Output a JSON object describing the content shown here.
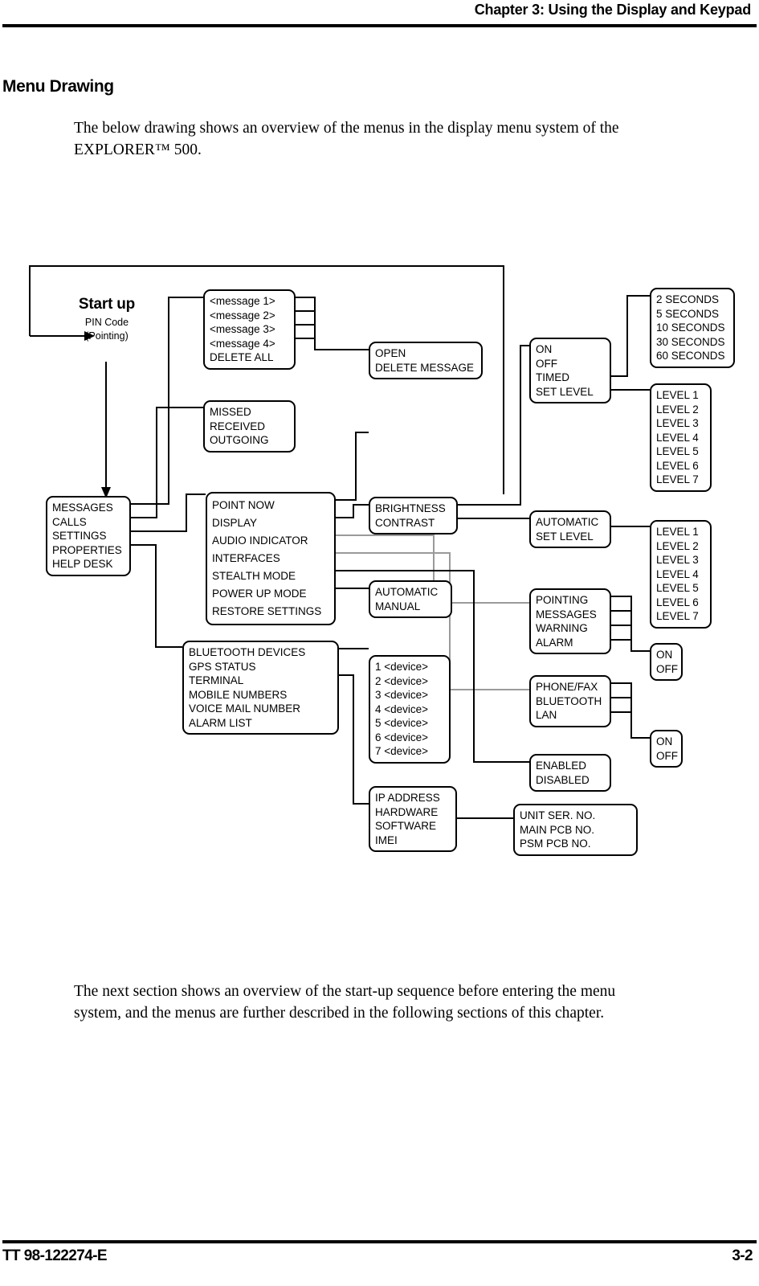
{
  "header": {
    "chapter_title": "Chapter 3: Using the Display and Keypad"
  },
  "section": {
    "heading": "Menu Drawing",
    "intro": "The below drawing shows an overview of the menus in the display menu system of the EXPLORER™ 500.",
    "closing": "The next section shows an overview of the start-up sequence before entering the menu system, and the menus are further described in the following sections of this chapter."
  },
  "footer": {
    "doc_number": "TT 98-122274-E",
    "page_number": "3-2"
  },
  "diagram": {
    "startup": {
      "title": "Start up",
      "line1": "PIN Code",
      "line2": "(Pointing)"
    },
    "nodes": {
      "main_menu": [
        "MESSAGES",
        "CALLS",
        "SETTINGS",
        "PROPERTIES",
        "HELP DESK"
      ],
      "messages_list": [
        "<message 1>",
        "<message 2>",
        "<message 3>",
        "<message 4>",
        "DELETE ALL"
      ],
      "message_actions": [
        "OPEN",
        "DELETE MESSAGE"
      ],
      "calls_list": [
        "MISSED",
        "RECEIVED",
        "OUTGOING"
      ],
      "settings_list": [
        "POINT NOW",
        "DISPLAY",
        "AUDIO INDICATOR",
        "INTERFACES",
        "STEALTH MODE",
        "POWER UP MODE",
        "RESTORE SETTINGS"
      ],
      "display_list": [
        "BRIGHTNESS",
        "CONTRAST"
      ],
      "backlight_list": [
        "ON",
        "OFF",
        "TIMED",
        "SET LEVEL"
      ],
      "timed_seconds": [
        "2 SECONDS",
        "5 SECONDS",
        "10 SECONDS",
        "30 SECONDS",
        "60 SECONDS"
      ],
      "brightness_levels": [
        "LEVEL 1",
        "LEVEL 2",
        "LEVEL 3",
        "LEVEL 4",
        "LEVEL 5",
        "LEVEL 6",
        "LEVEL 7"
      ],
      "contrast_mode": [
        "AUTOMATIC",
        "SET LEVEL"
      ],
      "contrast_levels": [
        "LEVEL 1",
        "LEVEL 2",
        "LEVEL 3",
        "LEVEL 4",
        "LEVEL 5",
        "LEVEL 6",
        "LEVEL 7"
      ],
      "audio_indicator_list": [
        "POINTING",
        "MESSAGES",
        "WARNING",
        "ALARM"
      ],
      "audio_on_off": [
        "ON",
        "OFF"
      ],
      "interfaces_list": [
        "PHONE/FAX",
        "BLUETOOTH",
        "LAN"
      ],
      "interfaces_on_off": [
        "ON",
        "OFF"
      ],
      "power_up_mode": [
        "AUTOMATIC",
        "MANUAL"
      ],
      "stealth_mode": [
        "ENABLED",
        "DISABLED"
      ],
      "properties_list": [
        "BLUETOOTH DEVICES",
        "GPS STATUS",
        "TERMINAL",
        "MOBILE NUMBERS",
        "VOICE MAIL NUMBER",
        "ALARM LIST"
      ],
      "bluetooth_devices": [
        "1 <device>",
        "2 <device>",
        "3 <device>",
        "4 <device>",
        "5 <device>",
        "6 <device>",
        "7 <device>"
      ],
      "terminal_list": [
        "IP ADDRESS",
        "HARDWARE",
        "SOFTWARE",
        "IMEI"
      ],
      "hardware_list": [
        "UNIT SER. NO.",
        "MAIN PCB NO.",
        "PSM PCB NO."
      ]
    }
  }
}
